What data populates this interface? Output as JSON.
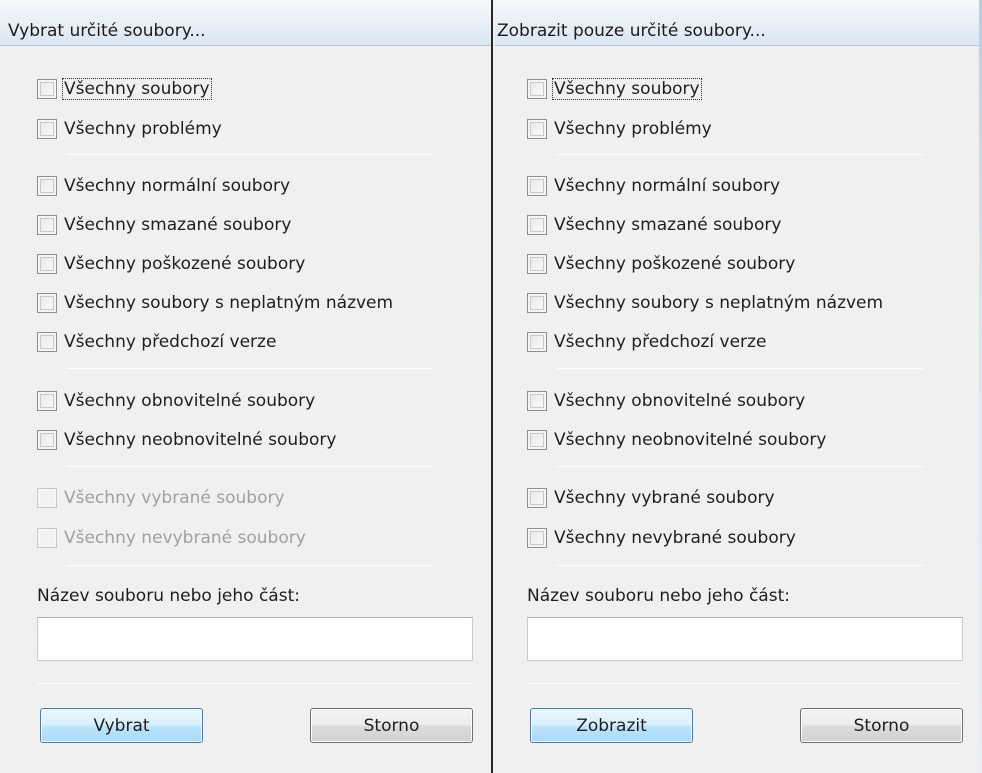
{
  "select_panel": {
    "title": "Vybrat určité soubory...",
    "checkboxes": [
      {
        "label": "Všechny soubory",
        "checked": false,
        "enabled": true
      },
      {
        "label": "Všechny problémy",
        "checked": false,
        "enabled": true
      },
      {
        "label": "Všechny normální soubory",
        "checked": false,
        "enabled": true
      },
      {
        "label": "Všechny smazané soubory",
        "checked": false,
        "enabled": true
      },
      {
        "label": "Všechny poškozené soubory",
        "checked": false,
        "enabled": true
      },
      {
        "label": "Všechny soubory s neplatným názvem",
        "checked": false,
        "enabled": true
      },
      {
        "label": "Všechny předchozí verze",
        "checked": false,
        "enabled": true
      },
      {
        "label": "Všechny obnovitelné soubory",
        "checked": false,
        "enabled": true
      },
      {
        "label": "Všechny neobnovitelné soubory",
        "checked": false,
        "enabled": true
      },
      {
        "label": "Všechny vybrané soubory",
        "checked": false,
        "enabled": false
      },
      {
        "label": "Všechny nevybrané soubory",
        "checked": false,
        "enabled": false
      }
    ],
    "filename_label": "Název souboru nebo jeho část:",
    "filename_value": "",
    "ok_label": "Vybrat",
    "cancel_label": "Storno"
  },
  "filter_panel": {
    "title": "Zobrazit pouze určité soubory...",
    "checkboxes": [
      {
        "label": "Všechny soubory",
        "checked": false,
        "enabled": true
      },
      {
        "label": "Všechny problémy",
        "checked": false,
        "enabled": true
      },
      {
        "label": "Všechny normální soubory",
        "checked": false,
        "enabled": true
      },
      {
        "label": "Všechny smazané soubory",
        "checked": false,
        "enabled": true
      },
      {
        "label": "Všechny poškozené soubory",
        "checked": false,
        "enabled": true
      },
      {
        "label": "Všechny soubory s neplatným názvem",
        "checked": false,
        "enabled": true
      },
      {
        "label": "Všechny předchozí verze",
        "checked": false,
        "enabled": true
      },
      {
        "label": "Všechny obnovitelné soubory",
        "checked": false,
        "enabled": true
      },
      {
        "label": "Všechny neobnovitelné soubory",
        "checked": false,
        "enabled": true
      },
      {
        "label": "Všechny vybrané soubory",
        "checked": false,
        "enabled": true
      },
      {
        "label": "Všechny nevybrané soubory",
        "checked": false,
        "enabled": true
      }
    ],
    "filename_label": "Název souboru nebo jeho část:",
    "filename_value": "",
    "ok_label": "Zobrazit",
    "cancel_label": "Storno"
  }
}
